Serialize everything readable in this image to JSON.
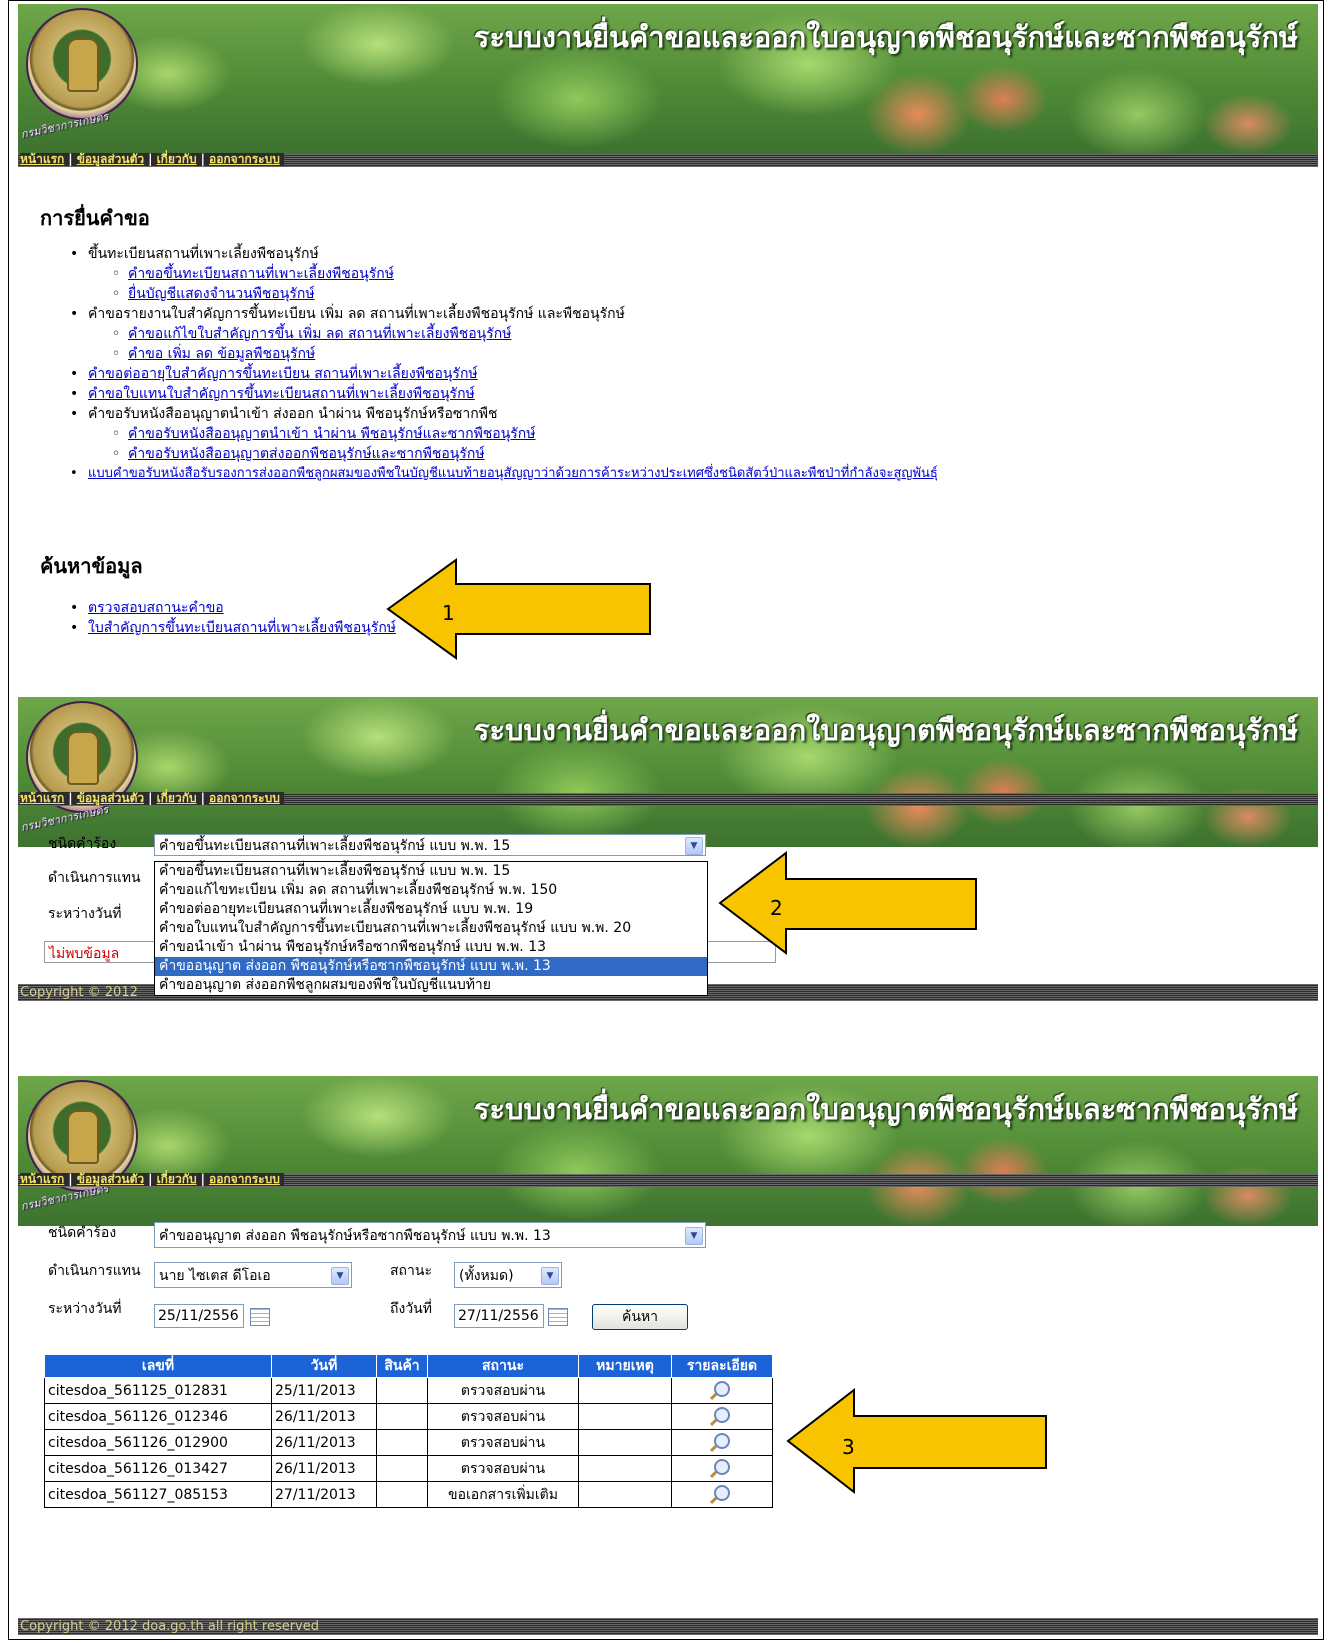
{
  "banner": {
    "title": "ระบบงานยื่นคำขอและออกใบอนุญาตพืชอนุรักษ์และซากพืชอนุรักษ์",
    "logo_text": "กรมวิชาการเกษตร"
  },
  "nav": {
    "home": "หน้าแรก",
    "profile": "ข้อมูลส่วนตัว",
    "about": "เกี่ยวกับ",
    "logout": "ออกจากระบบ",
    "sep": "|"
  },
  "panel1": {
    "heading_request": "การยื่นคำขอ",
    "items": [
      "ขึ้นทะเบียนสถานที่เพาะเลี้ยงพืชอนุรักษ์",
      "คำขอขึ้นทะเบียนสถานที่เพาะเลี้ยงพืชอนุรักษ์",
      "ยื่นบัญชีแสดงจำนวนพืชอนุรักษ์",
      "คำขอรายงานใบสำคัญการขึ้นทะเบียน เพิ่ม ลด สถานที่เพาะเลี้ยงพืชอนุรักษ์ และพืชอนุรักษ์",
      "คำขอแก้ไขใบสำคัญการขึ้น เพิ่ม ลด สถานที่เพาะเลี้ยงพืชอนุรักษ์",
      "คำขอ เพิ่ม ลด ข้อมูลพืชอนุรักษ์",
      "คำขอต่ออายุใบสำคัญการขึ้นทะเบียน สถานที่เพาะเลี้ยงพืชอนุรักษ์",
      "คำขอใบแทนใบสำคัญการขึ้นทะเบียนสถานที่เพาะเลี้ยงพืชอนุรักษ์",
      "คำขอรับหนังสืออนุญาตนำเข้า ส่งออก นำผ่าน พืชอนุรักษ์หรือซากพืช",
      "คำขอรับหนังสืออนุญาตนำเข้า นำผ่าน พืชอนุรักษ์และซากพืชอนุรักษ์",
      "คำขอรับหนังสืออนุญาตส่งออกพืชอนุรักษ์และซากพืชอนุรักษ์",
      "แบบคำขอรับหนังสือรับรองการส่งออกพืชลูกผสมของพืชในบัญชีแนบท้ายอนุสัญญาว่าด้วยการค้าระหว่างประเทศซึ่งชนิดสัตว์ป่าและพืชป่าที่กำลังจะสูญพันธุ์"
    ],
    "heading_search": "ค้นหาข้อมูล",
    "search_items": [
      "ตรวจสอบสถานะคำขอ",
      "ใบสำคัญการขึ้นทะเบียนสถานที่เพาะเลี้ยงพืชอนุรักษ์"
    ],
    "arrow_label": "1"
  },
  "panel2": {
    "label_type": "ชนิดคำร้อง",
    "label_onbehalf": "ดำเนินการแทน",
    "label_between": "ระหว่างวันที่",
    "selected": "คำขอขึ้นทะเบียนสถานที่เพาะเลี้ยงพืชอนุรักษ์ แบบ พ.พ. 15",
    "options": [
      "คำขอขึ้นทะเบียนสถานที่เพาะเลี้ยงพืชอนุรักษ์ แบบ พ.พ. 15",
      "คำขอแก้ไขทะเบียน เพิ่ม ลด สถานที่เพาะเลี้ยงพืชอนุรักษ์ พ.พ. 150",
      "คำขอต่ออายุทะเบียนสถานที่เพาะเลี้ยงพืชอนุรักษ์ แบบ พ.พ. 19",
      "คำขอใบแทนใบสำคัญการขึ้นทะเบียนสถานที่เพาะเลี้ยงพืชอนุรักษ์ แบบ พ.พ. 20",
      "คำขอนำเข้า นำผ่าน พืชอนุรักษ์หรือซากพืชอนุรักษ์ แบบ พ.พ. 13",
      "คำขออนุญาต ส่งออก พืชอนุรักษ์หรือซากพืชอนุรักษ์ แบบ พ.พ. 13",
      "คำขออนุญาต ส่งออกพืชลูกผสมของพืชในบัญชีแนบท้าย"
    ],
    "no_data": "ไม่พบข้อมูล",
    "footer": "Copyright © 2012",
    "arrow_label": "2"
  },
  "panel3": {
    "label_type": "ชนิดคำร้อง",
    "type_value": "คำขออนุญาต ส่งออก พืชอนุรักษ์หรือซากพืชอนุรักษ์ แบบ พ.พ. 13",
    "label_onbehalf": "ดำเนินการแทน",
    "onbehalf_value": "นาย ไซเตส ดีโอเอ",
    "label_status": "สถานะ",
    "status_value": "(ทั้งหมด)",
    "label_between": "ระหว่างวันที่",
    "date_from": "25/11/2556",
    "label_to": "ถึงวันที่",
    "date_to": "27/11/2556",
    "search_button": "ค้นหา",
    "columns": [
      "เลขที่",
      "วันที่",
      "สินค้า",
      "สถานะ",
      "หมายเหตุ",
      "รายละเอียด"
    ],
    "rows": [
      {
        "no": "citesdoa_561125_012831",
        "date": "25/11/2013",
        "status": "ตรวจสอบผ่าน"
      },
      {
        "no": "citesdoa_561126_012346",
        "date": "26/11/2013",
        "status": "ตรวจสอบผ่าน"
      },
      {
        "no": "citesdoa_561126_012900",
        "date": "26/11/2013",
        "status": "ตรวจสอบผ่าน"
      },
      {
        "no": "citesdoa_561126_013427",
        "date": "26/11/2013",
        "status": "ตรวจสอบผ่าน"
      },
      {
        "no": "citesdoa_561127_085153",
        "date": "27/11/2013",
        "status": "ขอเอกสารเพิ่มเติม"
      }
    ],
    "footer": "Copyright © 2012 doa.go.th all right reserved",
    "arrow_label": "3"
  },
  "colors": {
    "arrow_fill": "#f8c400",
    "nav_link": "#f3e26a",
    "table_header": "#1c63d8",
    "highlight": "#316ac5",
    "no_data": "#cc0000"
  }
}
